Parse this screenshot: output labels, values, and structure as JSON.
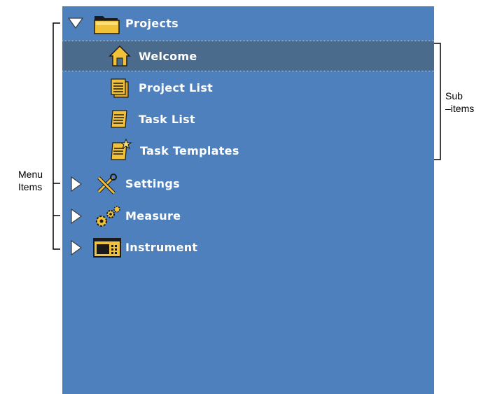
{
  "menu": {
    "items": [
      {
        "label": "Projects",
        "expanded": true,
        "icon": "folder-icon"
      },
      {
        "label": "Settings",
        "expanded": false,
        "icon": "tools-icon"
      },
      {
        "label": "Measure",
        "expanded": false,
        "icon": "gears-icon"
      },
      {
        "label": "Instrument",
        "expanded": false,
        "icon": "instrument-icon"
      }
    ],
    "subitems": [
      {
        "label": "Welcome",
        "selected": true,
        "icon": "home-icon"
      },
      {
        "label": "Project List",
        "selected": false,
        "icon": "project-list-icon"
      },
      {
        "label": "Task List",
        "selected": false,
        "icon": "task-list-icon"
      },
      {
        "label": "Task Templates",
        "selected": false,
        "icon": "task-templates-icon"
      }
    ]
  },
  "annotations": {
    "menu_items_line1": "Menu",
    "menu_items_line2": "Items",
    "sub_items_line1": "Sub",
    "sub_items_line2": "–items"
  },
  "colors": {
    "panel": "#4d80bd",
    "selected_row": "#4a6b8c",
    "icon_gold": "#f2c13a",
    "text": "#ffffff"
  }
}
